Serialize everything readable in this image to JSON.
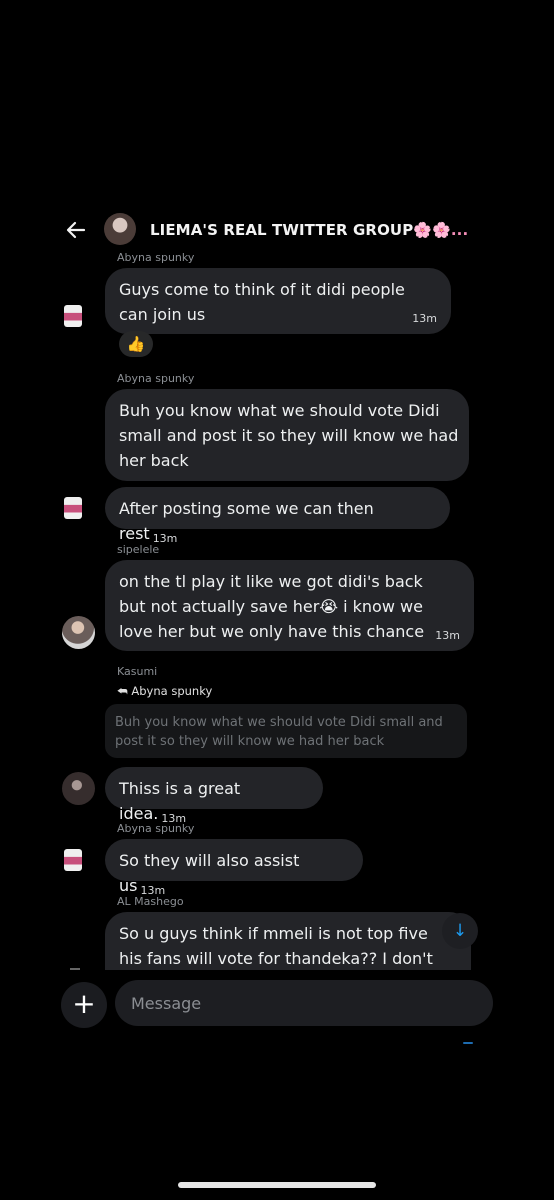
{
  "header": {
    "title": "LIEMA'S REAL TWITTER GROUP",
    "title_suffix": "🌸🌸..."
  },
  "messages": [
    {
      "sender": "Abyna spunky",
      "text": "Guys come to think of it didi people can join us",
      "time": "13m",
      "reaction": "👍"
    },
    {
      "sender": "Abyna spunky",
      "text": "Buh you know what we should vote Didi small and post it so they will know we had her back"
    },
    {
      "text": "After posting some we can then rest",
      "time": "13m"
    },
    {
      "sender": "sipelele",
      "text_before_emoji": "on the tl play it like we got didi's back but not actually save her",
      "emoji": "😭",
      "text_after_emoji": " i know we love her but we only have this chance",
      "time": "13m"
    },
    {
      "sender": "Kasumi",
      "reply_to": "Abyna spunky",
      "quoted_text": "Buh you know what we should vote Didi small and post it so they will know we had her back",
      "text": "Thiss is a great idea.",
      "time": "13m"
    },
    {
      "sender": "Abyna spunky",
      "text": "So they will also assist us",
      "time": "13m"
    },
    {
      "sender": "AL Mashego",
      "text": "So u guys think if mmeli is not top five his fans will vote for thandeka?? I don't think"
    }
  ],
  "reply_arrow": "⮪",
  "composer": {
    "add_label": "+",
    "placeholder": "Message"
  },
  "scroll_down_label": "↓",
  "colors": {
    "background": "#000000",
    "bubble": "#232428",
    "accent": "#1d9bf0",
    "sender_name": "#8b8f94"
  },
  "icons": [
    "back-arrow-icon",
    "plus-icon",
    "arrow-down-icon",
    "reply-icon"
  ]
}
